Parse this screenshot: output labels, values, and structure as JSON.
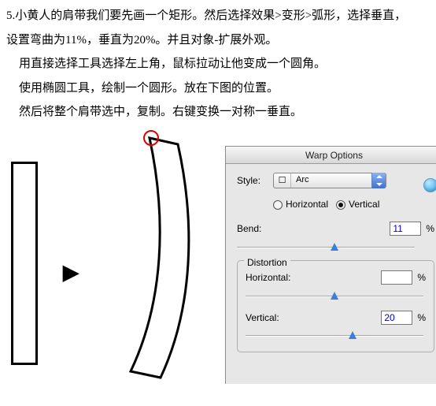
{
  "text": {
    "line1": "5.小黄人的肩带我们要先画一个矩形。然后选择效果>变形>弧形，选择垂直，",
    "line2": "设置弯曲为11%，垂直为20%。并且对象-扩展外观。",
    "line3": "用直接选择工具选择左上角，鼠标拉动让他变成一个圆角。",
    "line4": "使用椭圆工具，绘制一个圆形。放在下图的位置。",
    "line5": "然后将整个肩带选中，复制。右键变换一对称一垂直。"
  },
  "arrow": "▶",
  "panel": {
    "title": "Warp Options",
    "style_label": "Style:",
    "style_icon": "☐",
    "style_value": "Arc",
    "horizontal_label": "Horizontal",
    "vertical_label": "Vertical",
    "orientation": "vertical",
    "bend_label": "Bend:",
    "bend_value": "11",
    "distortion_label": "Distortion",
    "dist_h_label": "Horizontal:",
    "dist_h_value": "",
    "dist_v_label": "Vertical:",
    "dist_v_value": "20",
    "pct": "%"
  },
  "chart_data": {
    "type": "table",
    "title": "Warp Options",
    "style": "Arc",
    "orientation": "Vertical",
    "bend_percent": 11,
    "distortion_horizontal_percent": null,
    "distortion_vertical_percent": 20,
    "slider_range": [
      -100,
      100
    ]
  }
}
